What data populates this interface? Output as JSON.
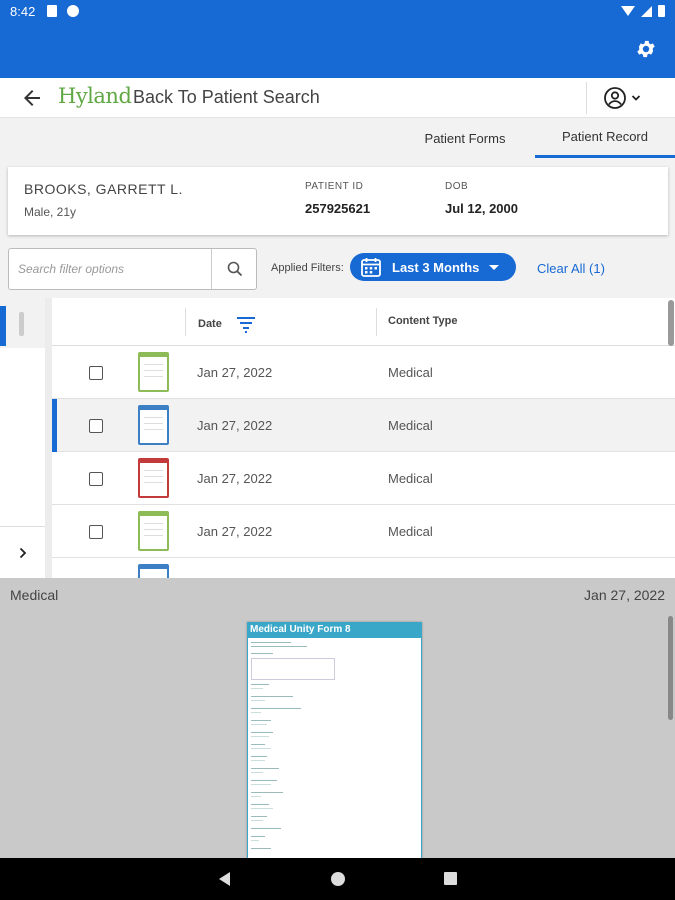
{
  "status_bar": {
    "time": "8:42"
  },
  "nav": {
    "logo_text": "Hyland",
    "title": "Back To Patient Search"
  },
  "tabs": [
    {
      "label": "Patient Forms",
      "active": false
    },
    {
      "label": "Patient Record",
      "active": true
    }
  ],
  "patient": {
    "name": "BROOKS, GARRETT L.",
    "demographics": "Male, 21y",
    "id_label": "PATIENT ID",
    "id_value": "257925621",
    "dob_label": "DOB",
    "dob_value": "Jul 12, 2000"
  },
  "filters": {
    "search_placeholder": "Search filter options",
    "applied_label": "Applied Filters:",
    "chip_label": "Last 3 Months",
    "clear_all": "Clear All (1)"
  },
  "table": {
    "columns": {
      "date": "Date",
      "content_type": "Content Type"
    },
    "rows": [
      {
        "date": "Jan 27, 2022",
        "content_type": "Medical",
        "thumb_color": "#8dbb57",
        "selected": false
      },
      {
        "date": "Jan 27, 2022",
        "content_type": "Medical",
        "thumb_color": "#3d7fc4",
        "selected": true
      },
      {
        "date": "Jan 27, 2022",
        "content_type": "Medical",
        "thumb_color": "#c33a3a",
        "selected": false
      },
      {
        "date": "Jan 27, 2022",
        "content_type": "Medical",
        "thumb_color": "#8dbb57",
        "selected": false
      },
      {
        "date": "",
        "content_type": "",
        "thumb_color": "#3d7fc4",
        "selected": false
      }
    ]
  },
  "preview": {
    "content_type": "Medical",
    "date": "Jan 27, 2022",
    "document_title": "Medical Unity Form 8"
  },
  "colors": {
    "primary": "#1769d4",
    "logo_green": "#5fa843",
    "doc_header": "#3aa7c8"
  },
  "icons": [
    "gear-icon",
    "back-arrow-icon",
    "user-account-icon",
    "search-icon",
    "calendar-icon",
    "sort-filter-icon",
    "chevron-right-icon"
  ]
}
